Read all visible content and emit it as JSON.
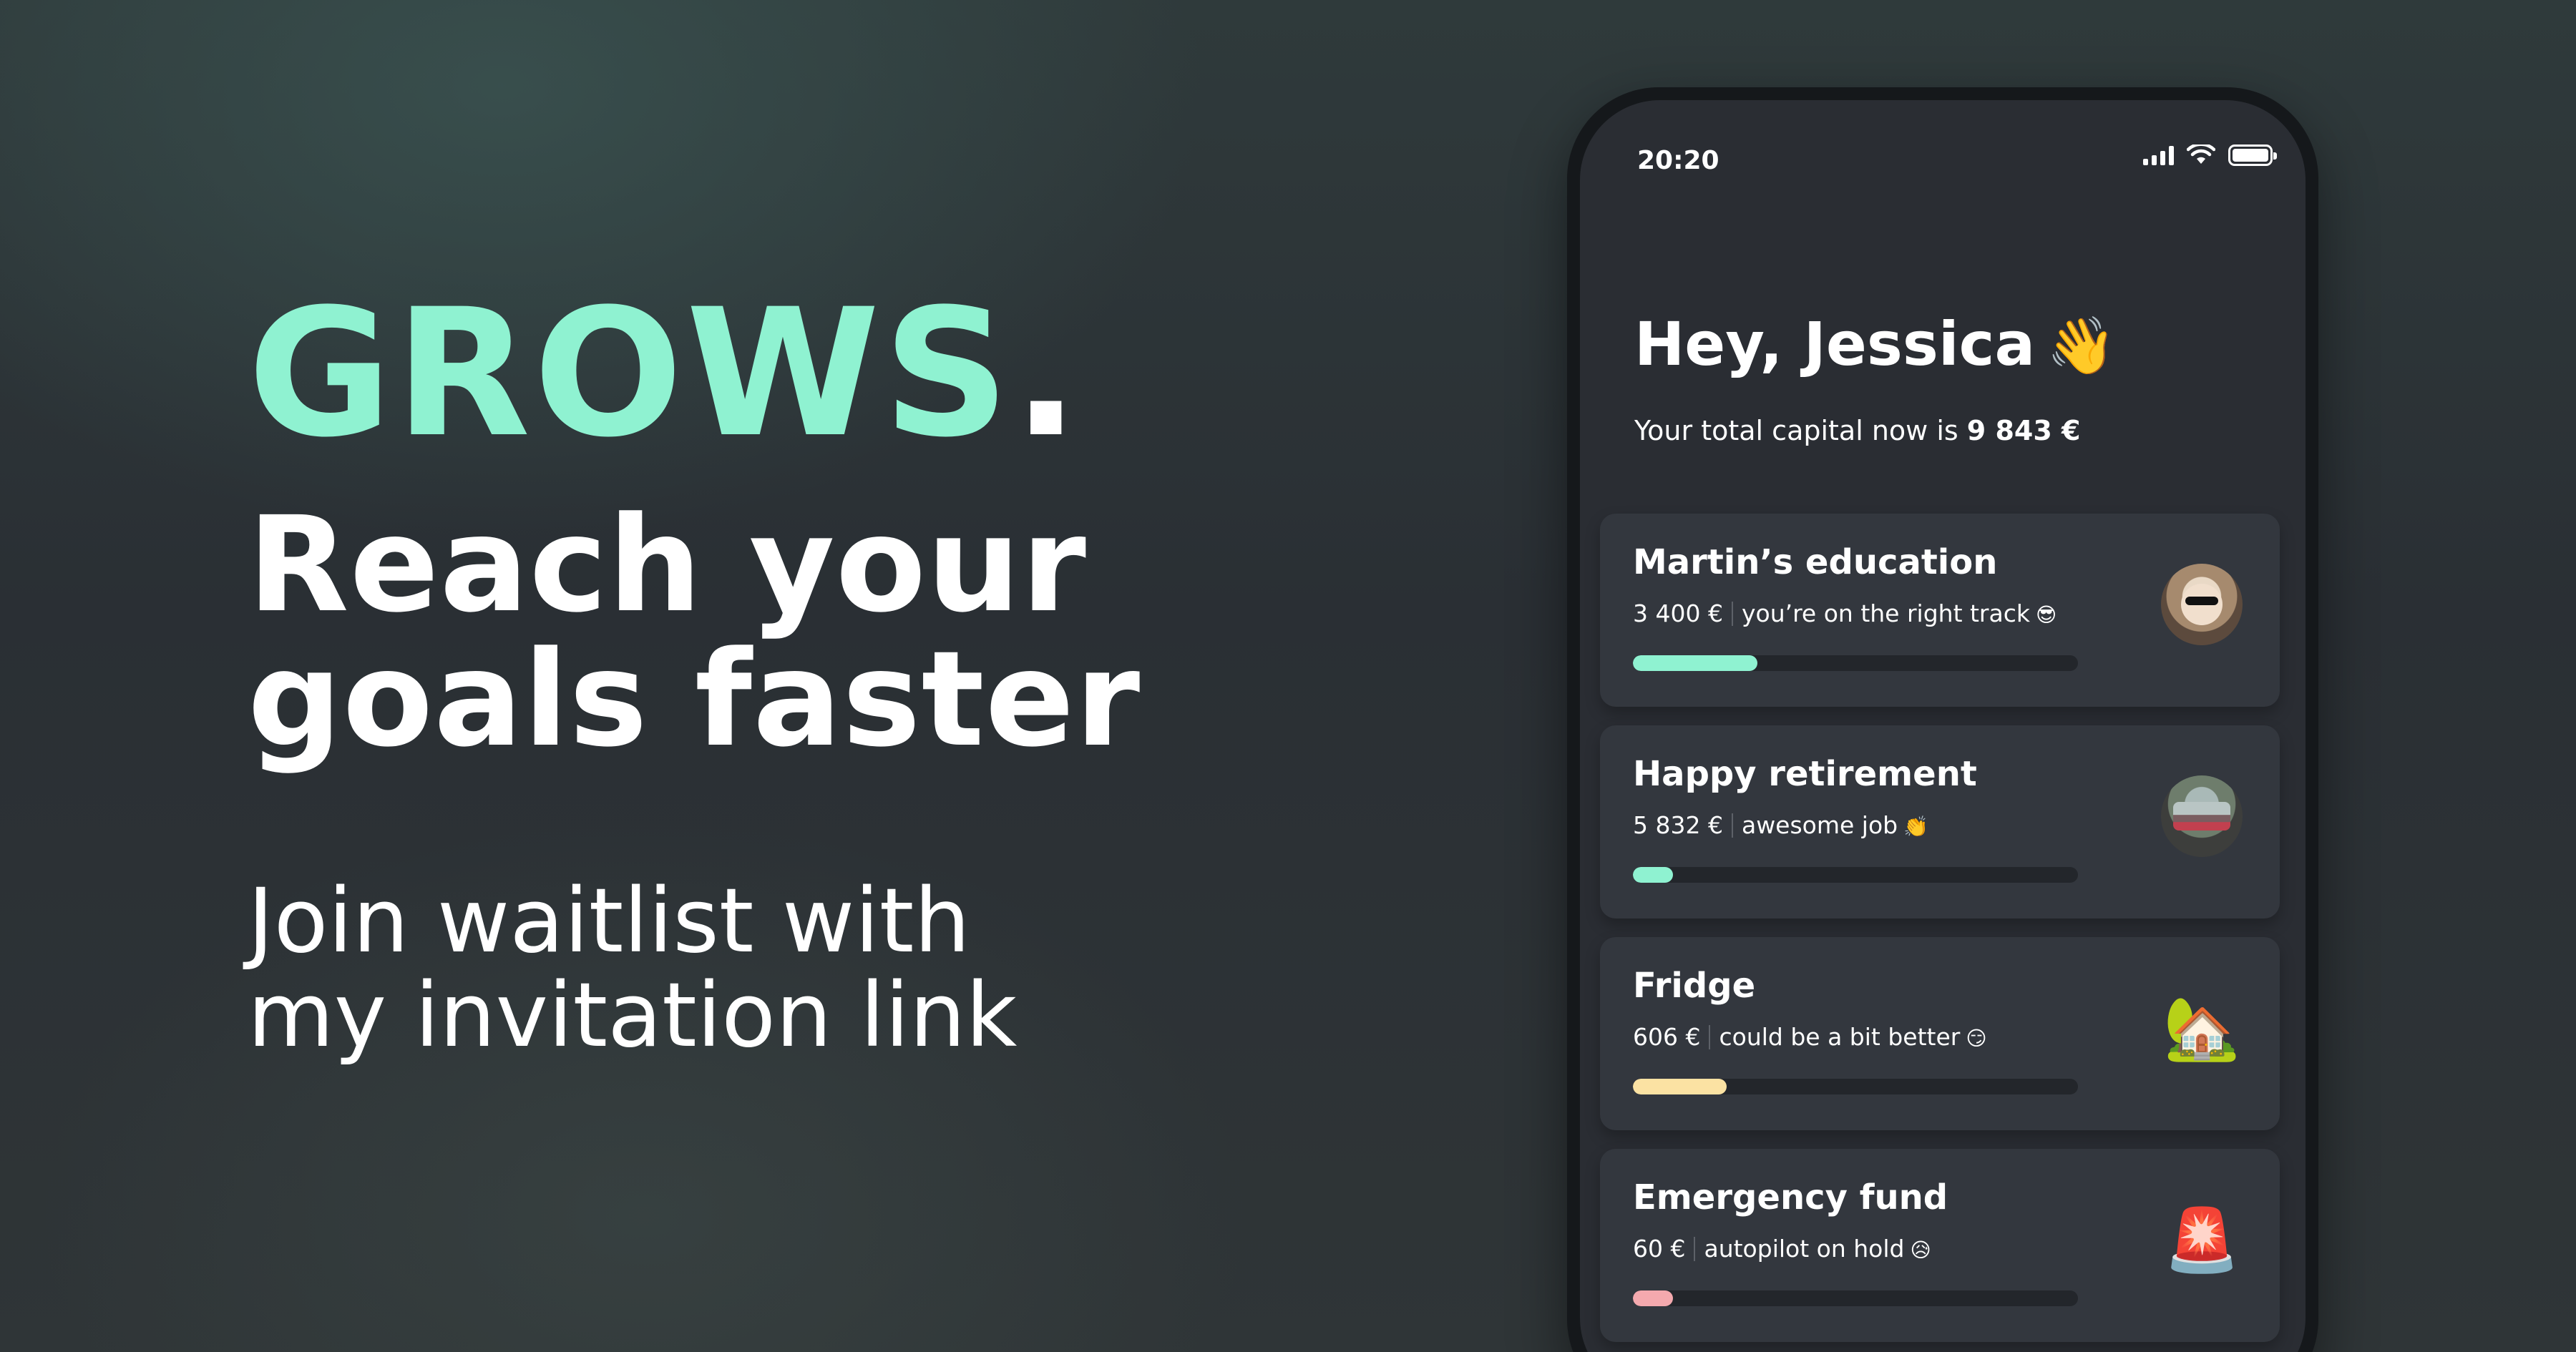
{
  "hero": {
    "brand": "GROWS",
    "brand_dot": ".",
    "headline_line1": "Reach your",
    "headline_line2": "goals faster",
    "cta_line1": "Join waitlist with",
    "cta_line2": "my invitation link"
  },
  "phone": {
    "status_time": "20:20",
    "greeting": "Hey, Jessica",
    "greeting_emoji": "👋",
    "capital_prefix": "Your total capital now is",
    "capital_amount": "9 843 €"
  },
  "goals": [
    {
      "title": "Martin’s education",
      "amount": "3 400 €",
      "status": "you’re on the right track",
      "status_emoji": "😎",
      "progress": 0.28,
      "bar_color": "#8ff2d1",
      "thumb": "photo-of-child"
    },
    {
      "title": "Happy retirement",
      "amount": "5 832 €",
      "status": "awesome job",
      "status_emoji": "👏",
      "progress": 0.09,
      "bar_color": "#8ff2d1",
      "thumb": "photo-of-car"
    },
    {
      "title": "Fridge",
      "amount": "606 €",
      "status": "could be a bit better",
      "status_emoji": "😏",
      "progress": 0.21,
      "bar_color": "#fbe2a3",
      "thumb_emoji": "🏡"
    },
    {
      "title": "Emergency fund",
      "amount": "60 €",
      "status": "autopilot on hold",
      "status_emoji": "😥",
      "progress": 0.09,
      "bar_color": "#f4a9ae",
      "thumb_emoji": "🚨"
    }
  ]
}
